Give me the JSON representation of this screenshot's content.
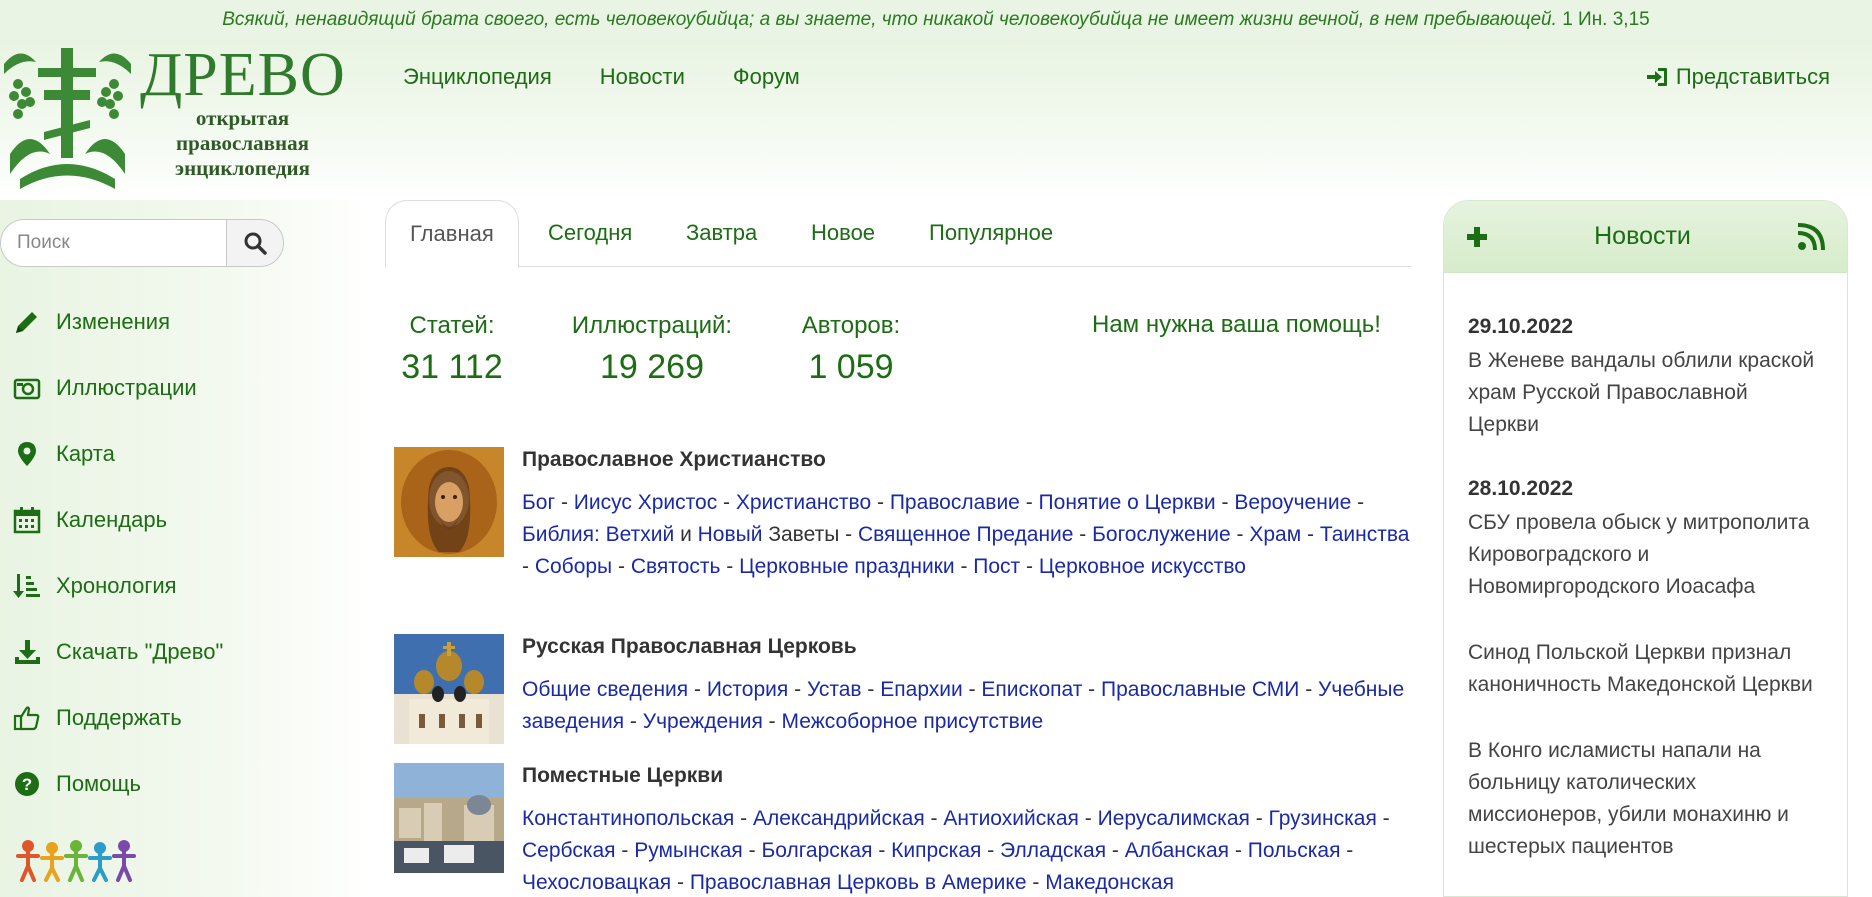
{
  "banner": {
    "verse": "Всякий, ненавидящий брата своего, есть человекоубийца; а вы знаете, что никакой человекоубийца не имеет жизни вечной, в нем пребывающей.",
    "ref": "1 Ин. 3,15"
  },
  "logo": {
    "title": "ДРЕВО",
    "subtitle": "открытая православная энциклопедия"
  },
  "topnav": [
    {
      "label": "Энциклопедия"
    },
    {
      "label": "Новости"
    },
    {
      "label": "Форум"
    }
  ],
  "login": {
    "label": "Представиться",
    "icon": "sign-in-icon"
  },
  "search": {
    "placeholder": "Поиск",
    "icon": "search-icon"
  },
  "sidebar": {
    "items": [
      {
        "label": "Изменения",
        "icon": "pencil-icon"
      },
      {
        "label": "Иллюстрации",
        "icon": "camera-icon"
      },
      {
        "label": "Карта",
        "icon": "map-marker-icon"
      },
      {
        "label": "Календарь",
        "icon": "calendar-icon"
      },
      {
        "label": "Хронология",
        "icon": "timeline-sort-icon"
      },
      {
        "label": "Скачать \"Древо\"",
        "icon": "download-icon"
      },
      {
        "label": "Поддержать",
        "icon": "thumbs-up-icon"
      },
      {
        "label": "Помощь",
        "icon": "question-circle-icon"
      }
    ]
  },
  "tabs": [
    {
      "label": "Главная"
    },
    {
      "label": "Сегодня"
    },
    {
      "label": "Завтра"
    },
    {
      "label": "Новое"
    },
    {
      "label": "Популярное"
    }
  ],
  "stats": {
    "articles": {
      "label": "Статей:",
      "value": "31 112"
    },
    "illustrations": {
      "label": "Иллюстраций:",
      "value": "19 269"
    },
    "authors": {
      "label": "Авторов:",
      "value": "1 059"
    },
    "help": "Нам нужна ваша помощь!"
  },
  "sections": [
    {
      "title": "Православное Христианство",
      "links": [
        "Бог",
        "Иисус Христос",
        "Христианство",
        "Православие",
        "Понятие о Церкви",
        "Вероучение",
        "Библия:",
        "Ветхий",
        "и",
        "Новый",
        "Заветы",
        "Священное Предание",
        "Богослужение",
        "Храм",
        "Таинства",
        "Соборы",
        "Святость",
        "Церковные праздники",
        "Пост",
        "Церковное искусство"
      ]
    },
    {
      "title": "Русская Православная Церковь",
      "links": [
        "Общие сведения",
        "История",
        "Устав",
        "Епархии",
        "Епископат",
        "Православные СМИ",
        "Учебные заведения",
        "Учреждения",
        "Межсоборное присутствие"
      ]
    },
    {
      "title": "Поместные Церкви",
      "links": [
        "Константинопольская",
        "Александрийская",
        "Антиохийская",
        "Иерусалимская",
        "Грузинская",
        "Сербская",
        "Румынская",
        "Болгарская",
        "Кипрская",
        "Элладская",
        "Албанская",
        "Польская",
        "Чехословацкая",
        "Православная Церковь в Америке",
        "Македонская"
      ]
    }
  ],
  "news": {
    "title": "Новости",
    "items": [
      {
        "date": "29.10.2022",
        "text": "В Женеве вандалы облили краской храм Русской Православной Церкви"
      },
      {
        "date": "28.10.2022",
        "text": "СБУ провела обыск у митрополита Кировоградского и Новомиргородского Иоасафа"
      },
      {
        "date": "",
        "text": "Синод Польской Церкви признал каноничность Македонской Церкви"
      },
      {
        "date": "",
        "text": "В Конго исламисты напали на больницу католических миссионеров, убили монахиню и шестерых пациентов"
      }
    ]
  },
  "colors": {
    "accent": "#1c6d14",
    "link": "#1a2aa6",
    "banner_bg": "#e9f4e4"
  }
}
